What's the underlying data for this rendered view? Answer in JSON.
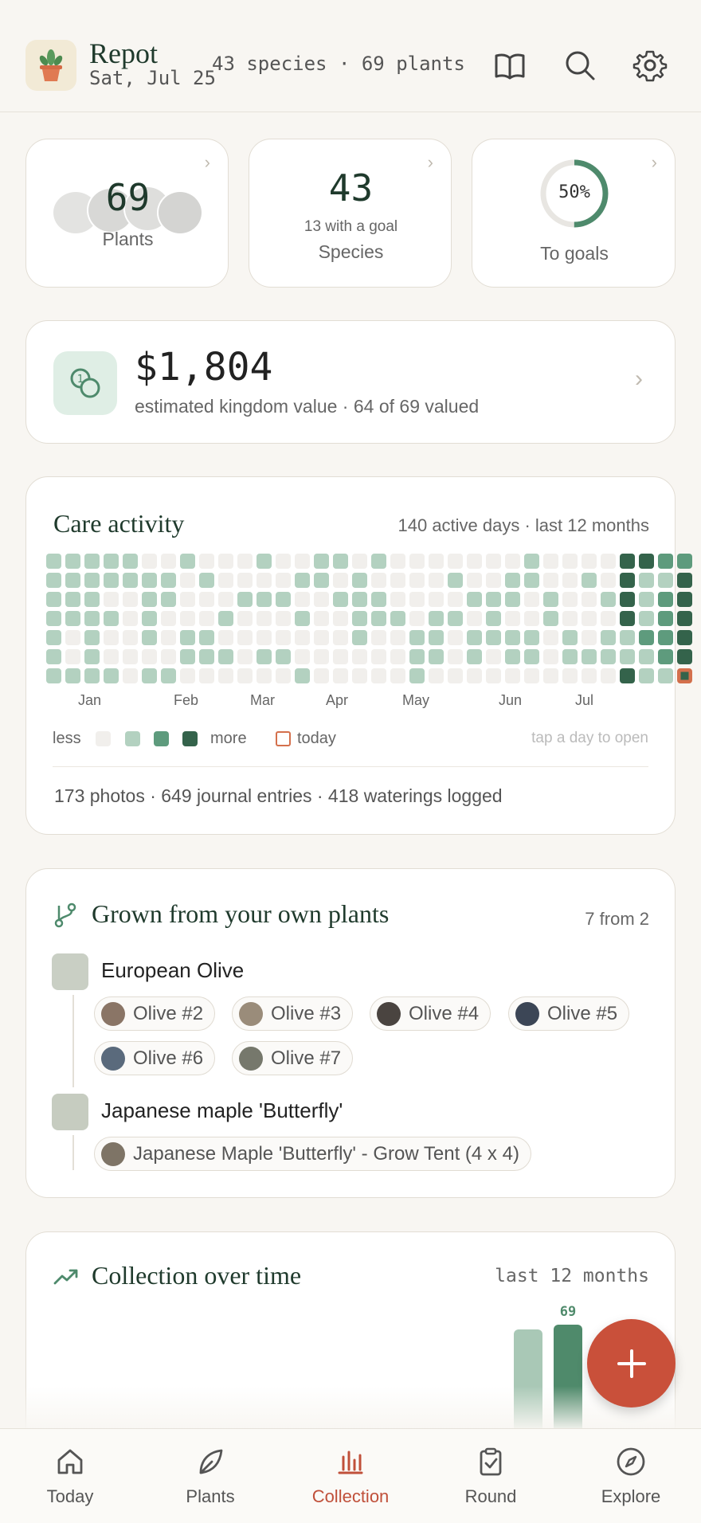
{
  "header": {
    "title": "Repot",
    "date": "Sat, Jul 25",
    "summary": "43 species · 69 plants",
    "icons": [
      "book-icon",
      "search-icon",
      "gear-icon"
    ]
  },
  "stats": [
    {
      "value": "69",
      "label": "Plants"
    },
    {
      "value": "43",
      "sub": "13 with a goal",
      "label": "Species"
    },
    {
      "percent_text": "50%",
      "label": "To goals",
      "progress": 0.5
    }
  ],
  "value_card": {
    "amount": "$1,804",
    "caption": "estimated kingdom value · 64 of 69 valued"
  },
  "care": {
    "title": "Care activity",
    "summary": "140 active days · last 12 months",
    "months": [
      "Jan",
      "Feb",
      "Mar",
      "Apr",
      "May",
      "Jun",
      "Jul"
    ],
    "legend": {
      "less": "less",
      "more": "more",
      "today": "today"
    },
    "hint": "tap a day to open",
    "footer": "173 photos · 649 journal entries · 418 waterings logged",
    "colors": [
      "#f1efec",
      "#b3d1c0",
      "#5e9b7d",
      "#34634b"
    ],
    "weeks": [
      [
        1,
        1,
        1,
        1,
        1,
        1,
        1
      ],
      [
        1,
        1,
        1,
        1,
        0,
        0,
        1
      ],
      [
        1,
        1,
        1,
        1,
        1,
        1,
        1
      ],
      [
        1,
        1,
        0,
        1,
        0,
        0,
        1
      ],
      [
        1,
        1,
        0,
        0,
        0,
        0,
        0
      ],
      [
        0,
        1,
        1,
        1,
        1,
        0,
        1
      ],
      [
        0,
        1,
        1,
        0,
        0,
        0,
        1
      ],
      [
        1,
        0,
        0,
        0,
        1,
        1,
        0
      ],
      [
        0,
        1,
        0,
        0,
        1,
        1,
        0
      ],
      [
        0,
        0,
        0,
        1,
        0,
        1,
        0
      ],
      [
        0,
        0,
        1,
        0,
        0,
        0,
        0
      ],
      [
        1,
        0,
        1,
        0,
        0,
        1,
        0
      ],
      [
        0,
        0,
        1,
        0,
        0,
        1,
        0
      ],
      [
        0,
        1,
        0,
        1,
        0,
        0,
        1
      ],
      [
        1,
        1,
        0,
        0,
        0,
        0,
        0
      ],
      [
        1,
        0,
        1,
        0,
        0,
        0,
        0
      ],
      [
        0,
        1,
        1,
        1,
        1,
        0,
        0
      ],
      [
        1,
        0,
        1,
        1,
        0,
        0,
        0
      ],
      [
        0,
        0,
        0,
        1,
        0,
        0,
        0
      ],
      [
        0,
        0,
        0,
        0,
        1,
        1,
        1
      ],
      [
        0,
        0,
        0,
        1,
        1,
        1,
        0
      ],
      [
        0,
        1,
        0,
        1,
        0,
        0,
        0
      ],
      [
        0,
        0,
        1,
        0,
        1,
        1,
        0
      ],
      [
        0,
        0,
        1,
        1,
        1,
        0,
        0
      ],
      [
        0,
        1,
        1,
        0,
        1,
        1,
        0
      ],
      [
        1,
        1,
        0,
        0,
        1,
        1,
        0
      ],
      [
        0,
        0,
        1,
        1,
        0,
        0,
        0
      ],
      [
        0,
        0,
        0,
        0,
        1,
        1,
        0
      ],
      [
        0,
        1,
        0,
        0,
        0,
        1,
        0
      ],
      [
        0,
        0,
        1,
        0,
        1,
        1,
        0
      ],
      [
        3,
        3,
        3,
        3,
        1,
        1,
        3
      ],
      [
        3,
        1,
        1,
        1,
        2,
        1,
        1
      ],
      [
        2,
        1,
        2,
        2,
        2,
        2,
        1
      ],
      [
        2,
        3,
        3,
        3,
        3,
        3,
        3
      ]
    ]
  },
  "grown": {
    "title": "Grown from your own plants",
    "count": "7 from 2",
    "parents": [
      {
        "name": "European Olive",
        "children": [
          "Olive #2",
          "Olive #3",
          "Olive #4",
          "Olive #5",
          "Olive #6",
          "Olive #7"
        ]
      },
      {
        "name": "Japanese maple 'Butterfly'",
        "children": [
          "Japanese Maple 'Butterfly' - Grow Tent (4 x 4)"
        ]
      }
    ]
  },
  "collection": {
    "title": "Collection over time",
    "range": "last 12 months",
    "bar_value": "69"
  },
  "fab": {
    "label": "+"
  },
  "nav": {
    "items": [
      "Today",
      "Plants",
      "Collection",
      "Round",
      "Explore"
    ],
    "active": "Collection",
    "active_color": "#c0503a"
  }
}
